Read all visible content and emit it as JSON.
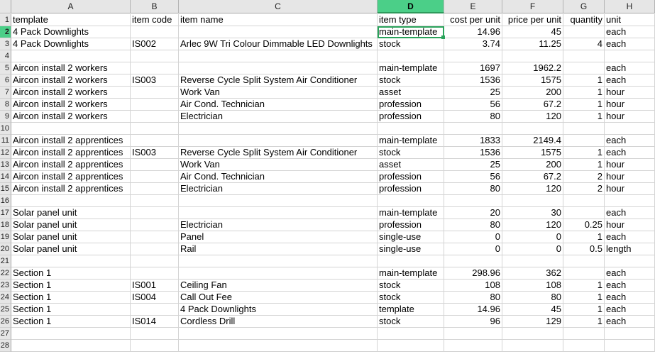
{
  "columns": [
    "A",
    "B",
    "C",
    "D",
    "E",
    "F",
    "G",
    "H"
  ],
  "active_column": "D",
  "selected_cell": {
    "row": 2,
    "col": "D"
  },
  "header_row": {
    "number": "1",
    "cells": [
      "template",
      "item code",
      "item name",
      "item type",
      "cost per unit",
      "price per unit",
      "quantity",
      "unit"
    ]
  },
  "rows": [
    {
      "number": "2",
      "cells": [
        "4 Pack Downlights",
        "",
        "",
        "main-template",
        "14.96",
        "45",
        "",
        "each"
      ]
    },
    {
      "number": "3",
      "cells": [
        "4 Pack Downlights",
        "IS002",
        "Arlec 9W Tri Colour Dimmable LED Downlights",
        "stock",
        "3.74",
        "11.25",
        "4",
        "each"
      ]
    },
    {
      "number": "4",
      "cells": [
        "",
        "",
        "",
        "",
        "",
        "",
        "",
        ""
      ]
    },
    {
      "number": "5",
      "cells": [
        "Aircon install 2 workers",
        "",
        "",
        "main-template",
        "1697",
        "1962.2",
        "",
        "each"
      ]
    },
    {
      "number": "6",
      "cells": [
        "Aircon install 2 workers",
        "IS003",
        "Reverse Cycle Split System Air Conditioner",
        "stock",
        "1536",
        "1575",
        "1",
        "each"
      ]
    },
    {
      "number": "7",
      "cells": [
        "Aircon install 2 workers",
        "",
        "Work Van",
        "asset",
        "25",
        "200",
        "1",
        "hour"
      ]
    },
    {
      "number": "8",
      "cells": [
        "Aircon install 2 workers",
        "",
        "Air Cond. Technician",
        "profession",
        "56",
        "67.2",
        "1",
        "hour"
      ]
    },
    {
      "number": "9",
      "cells": [
        "Aircon install 2 workers",
        "",
        "Electrician",
        "profession",
        "80",
        "120",
        "1",
        "hour"
      ]
    },
    {
      "number": "10",
      "cells": [
        "",
        "",
        "",
        "",
        "",
        "",
        "",
        ""
      ]
    },
    {
      "number": "11",
      "cells": [
        "Aircon install 2 apprentices",
        "",
        "",
        "main-template",
        "1833",
        "2149.4",
        "",
        "each"
      ]
    },
    {
      "number": "12",
      "cells": [
        "Aircon install 2 apprentices",
        "IS003",
        "Reverse Cycle Split System Air Conditioner",
        "stock",
        "1536",
        "1575",
        "1",
        "each"
      ]
    },
    {
      "number": "13",
      "cells": [
        "Aircon install 2 apprentices",
        "",
        "Work Van",
        "asset",
        "25",
        "200",
        "1",
        "hour"
      ]
    },
    {
      "number": "14",
      "cells": [
        "Aircon install 2 apprentices",
        "",
        "Air Cond. Technician",
        "profession",
        "56",
        "67.2",
        "2",
        "hour"
      ]
    },
    {
      "number": "15",
      "cells": [
        "Aircon install 2 apprentices",
        "",
        "Electrician",
        "profession",
        "80",
        "120",
        "2",
        "hour"
      ]
    },
    {
      "number": "16",
      "cells": [
        "",
        "",
        "",
        "",
        "",
        "",
        "",
        ""
      ]
    },
    {
      "number": "17",
      "cells": [
        "Solar panel unit",
        "",
        "",
        "main-template",
        "20",
        "30",
        "",
        "each"
      ]
    },
    {
      "number": "18",
      "cells": [
        "Solar panel unit",
        "",
        "Electrician",
        "profession",
        "80",
        "120",
        "0.25",
        "hour"
      ]
    },
    {
      "number": "19",
      "cells": [
        "Solar panel unit",
        "",
        "Panel",
        "single-use",
        "0",
        "0",
        "1",
        "each"
      ]
    },
    {
      "number": "20",
      "cells": [
        "Solar panel unit",
        "",
        "Rail",
        "single-use",
        "0",
        "0",
        "0.5",
        "length"
      ]
    },
    {
      "number": "21",
      "cells": [
        "",
        "",
        "",
        "",
        "",
        "",
        "",
        ""
      ]
    },
    {
      "number": "22",
      "cells": [
        "Section 1",
        "",
        "",
        "main-template",
        "298.96",
        "362",
        "",
        "each"
      ]
    },
    {
      "number": "23",
      "cells": [
        "Section 1",
        "IS001",
        "Ceiling Fan",
        "stock",
        "108",
        "108",
        "1",
        "each"
      ]
    },
    {
      "number": "24",
      "cells": [
        "Section 1",
        "IS004",
        "Call Out Fee",
        "stock",
        "80",
        "80",
        "1",
        "each"
      ]
    },
    {
      "number": "25",
      "cells": [
        "Section 1",
        "",
        "4 Pack Downlights",
        "template",
        "14.96",
        "45",
        "1",
        "each"
      ]
    },
    {
      "number": "26",
      "cells": [
        "Section 1",
        "IS014",
        "Cordless Drill",
        "stock",
        "96",
        "129",
        "1",
        "each"
      ]
    },
    {
      "number": "27",
      "cells": [
        "",
        "",
        "",
        "",
        "",
        "",
        "",
        ""
      ]
    },
    {
      "number": "28",
      "cells": [
        "",
        "",
        "",
        "",
        "",
        "",
        "",
        ""
      ]
    }
  ],
  "colors": {
    "accent": "#2aa35b",
    "header_active": "#4bcf88",
    "header_bg": "#e6e6e6",
    "grid": "#d4d4d4"
  }
}
